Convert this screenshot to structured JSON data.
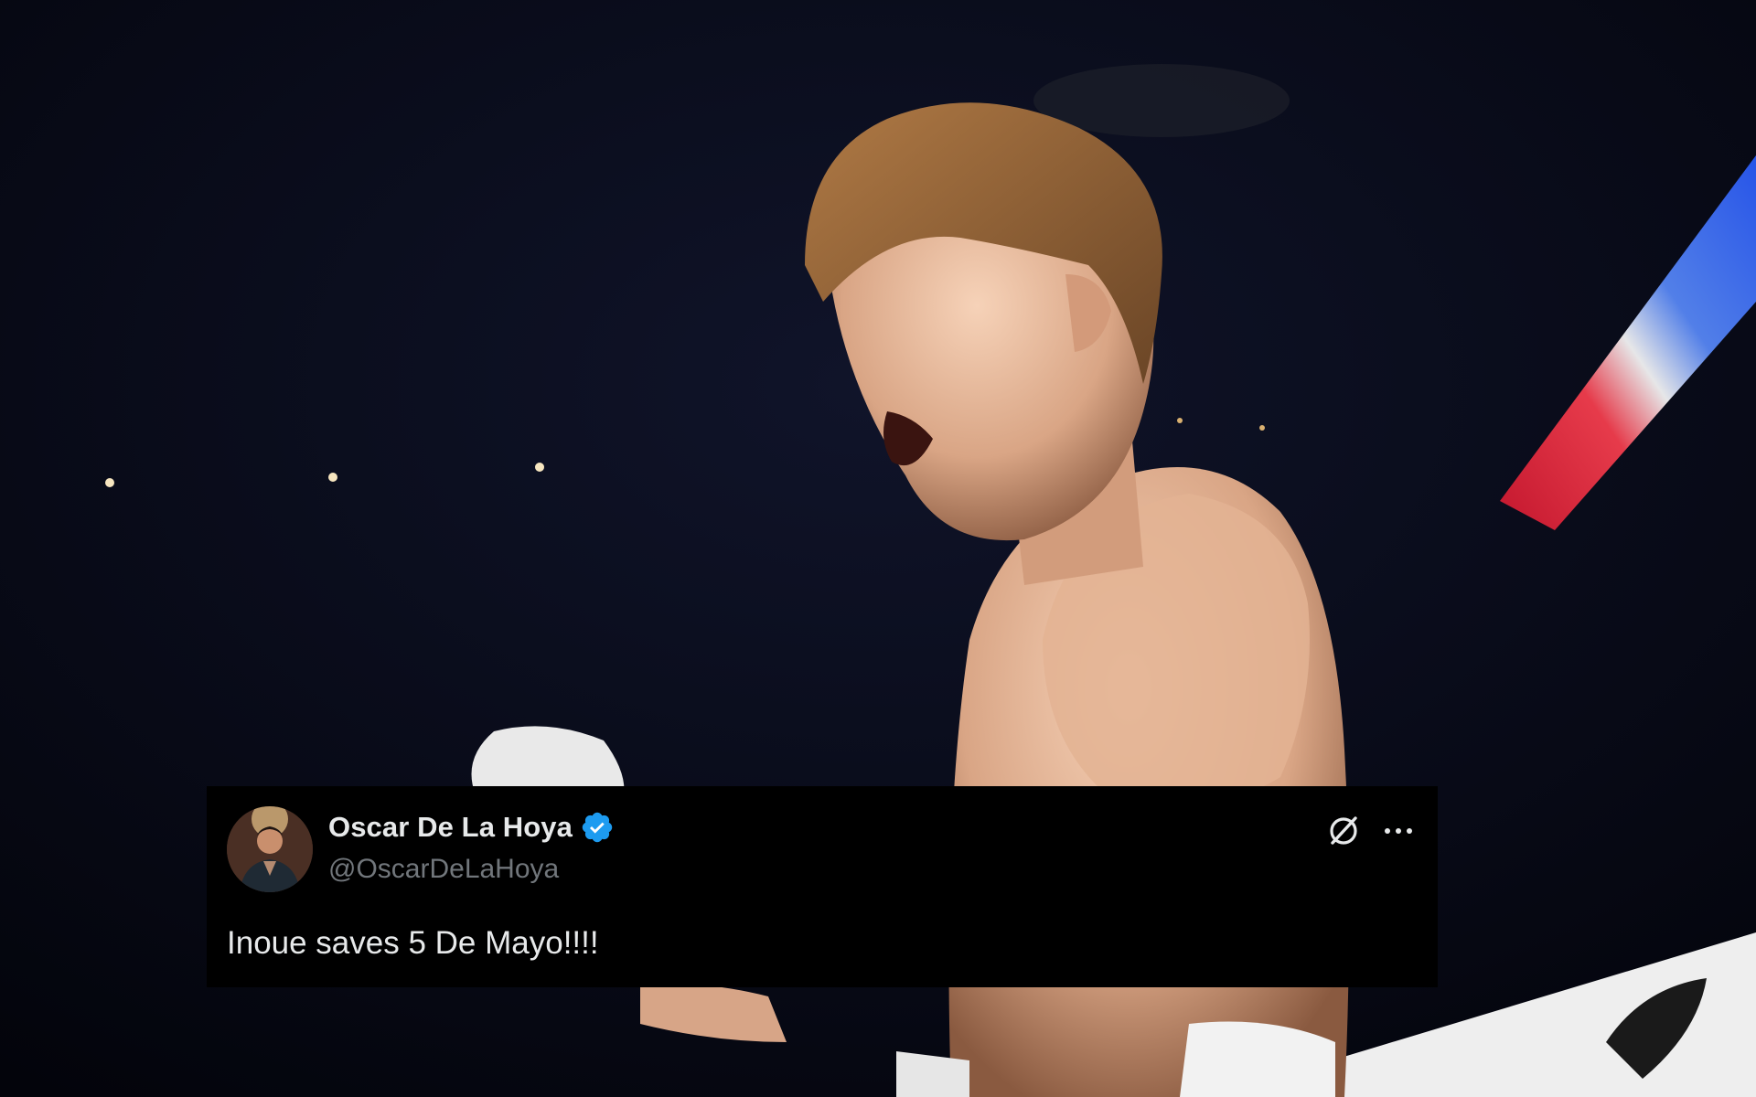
{
  "tweet": {
    "display_name": "Oscar De La Hoya",
    "handle": "@OscarDeLaHoya",
    "text": "Inoue saves 5 De Mayo!!!!",
    "verified": true
  },
  "colors": {
    "card_background": "#000000",
    "name_text": "#e7e9ea",
    "handle_text": "#71767b",
    "verified_badge": "#1d9bf0",
    "photo_background": "#050712"
  },
  "icons": {
    "verified": "verified-badge-icon",
    "grok": "grok-icon",
    "more": "more-horizontal-icon"
  }
}
